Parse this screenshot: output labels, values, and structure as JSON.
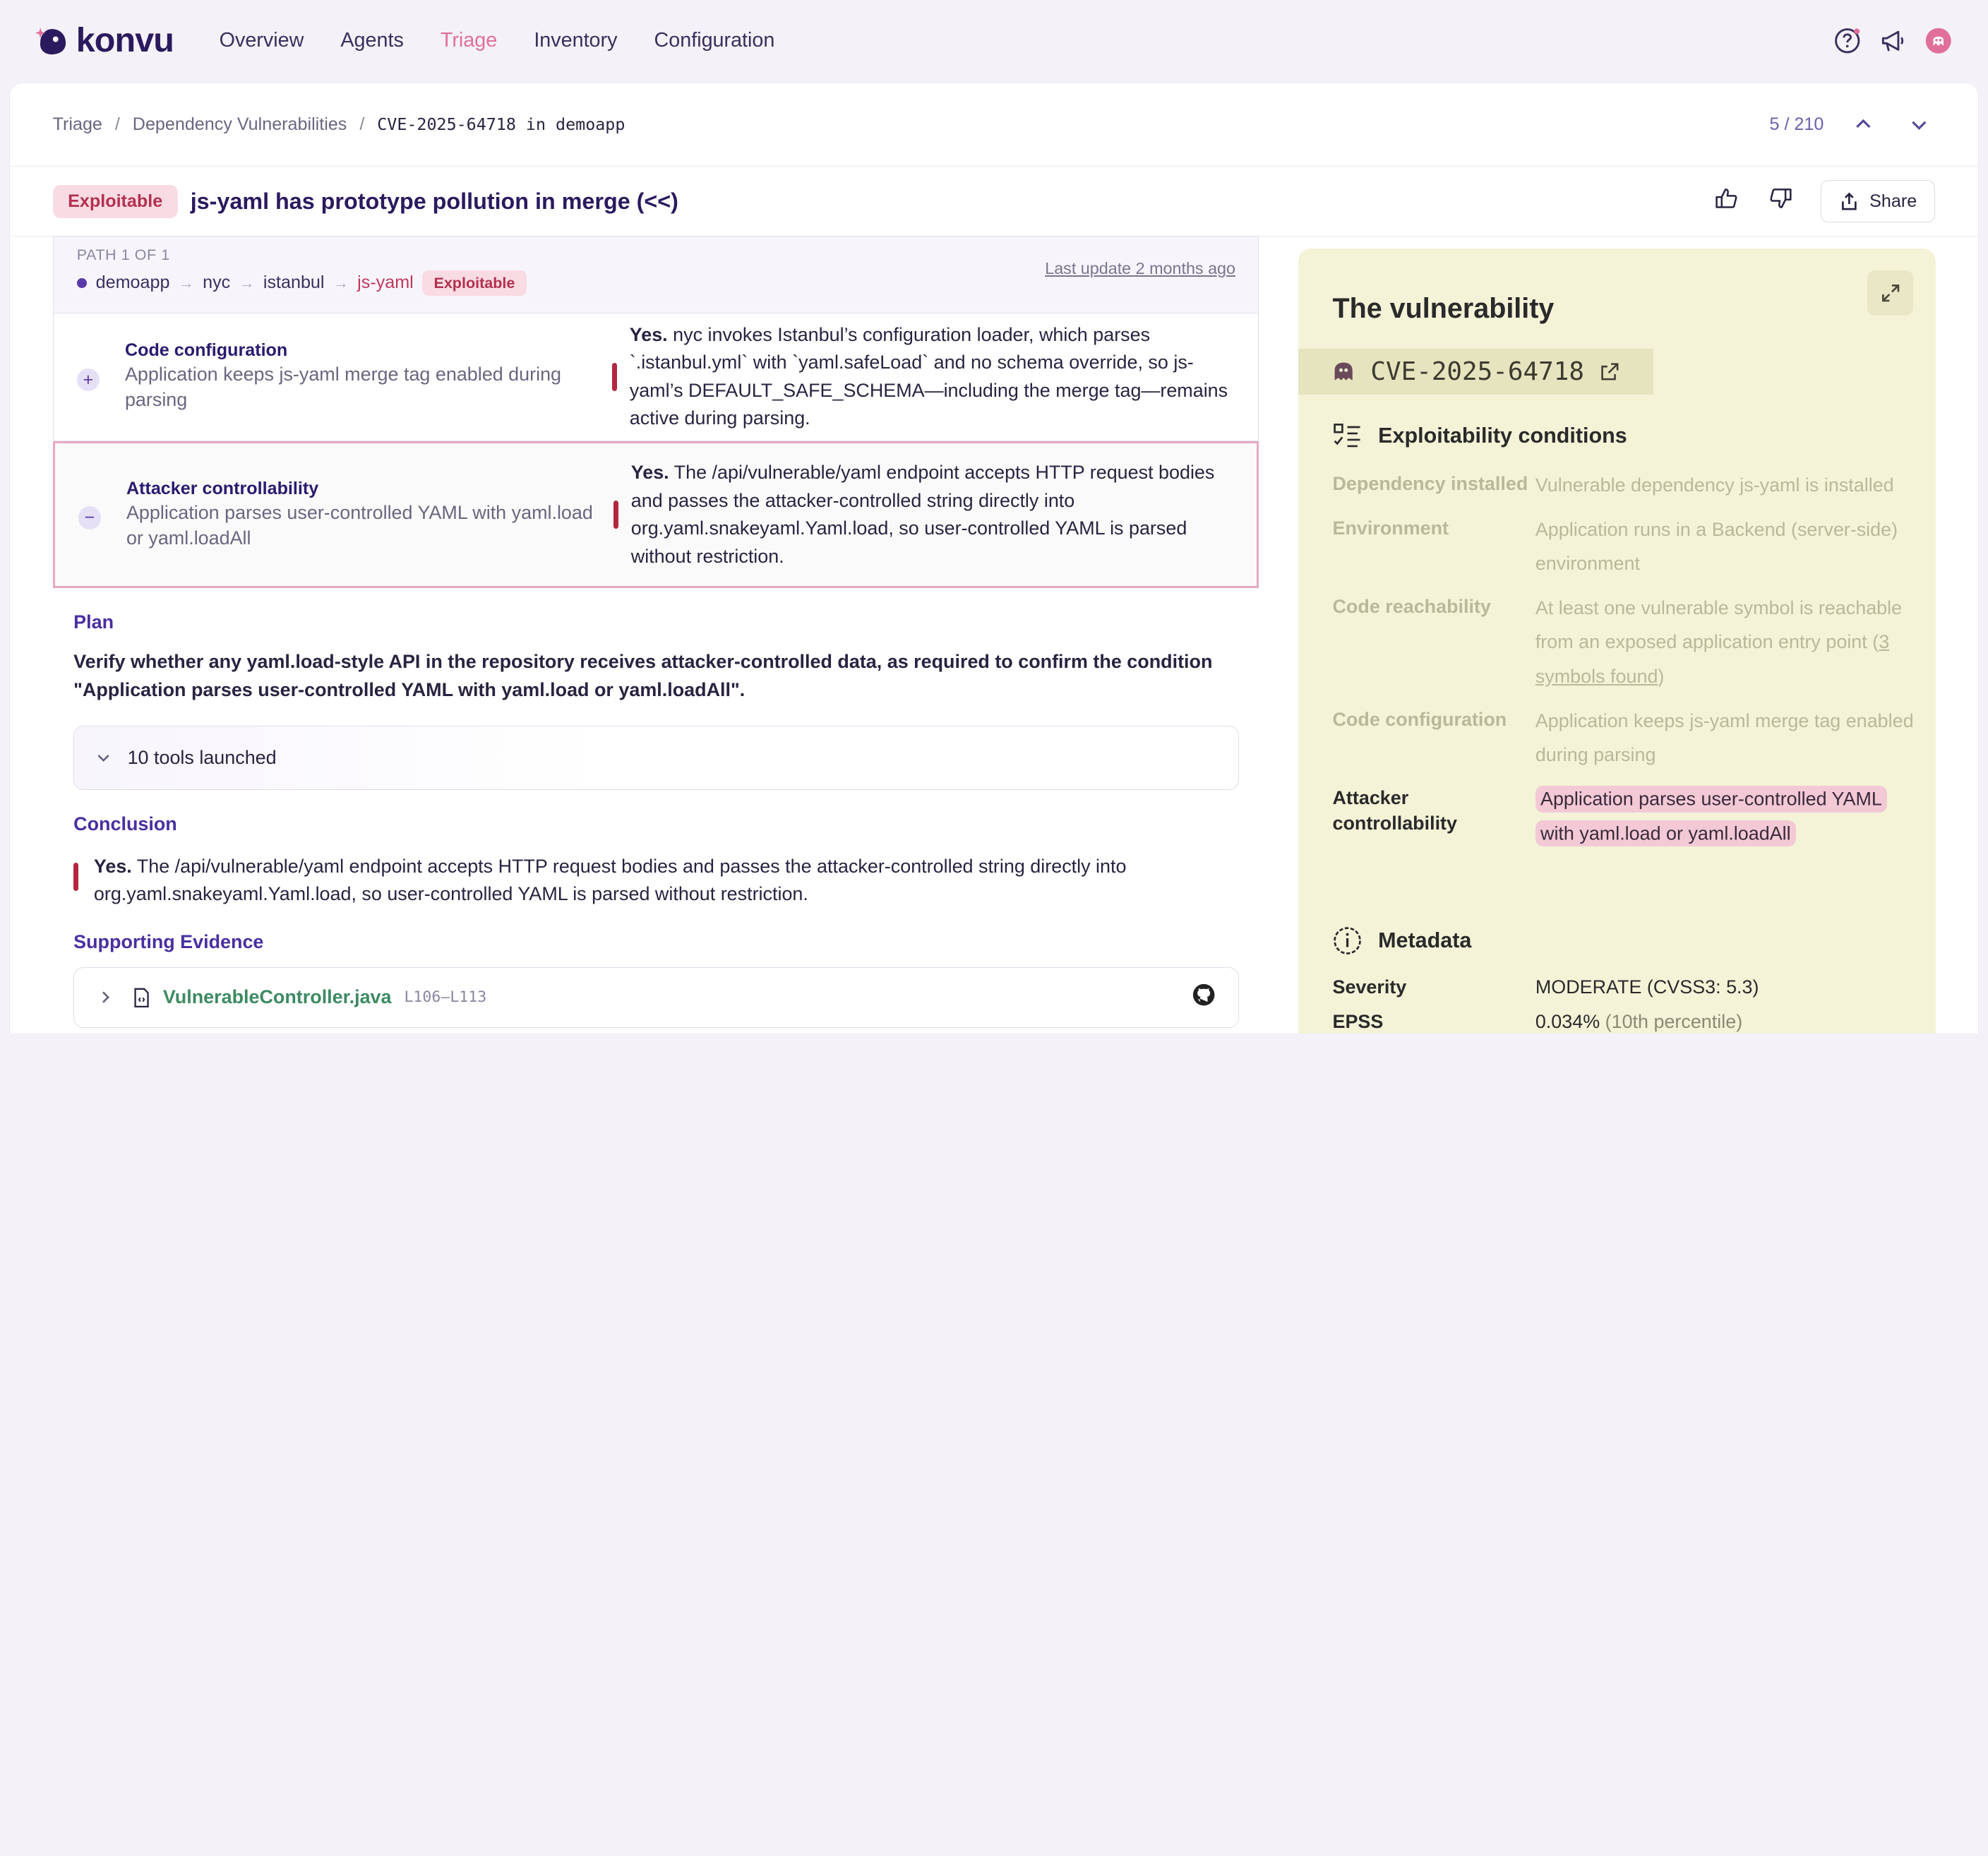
{
  "nav": {
    "logo_text": "konvu",
    "items": [
      "Overview",
      "Agents",
      "Triage",
      "Inventory",
      "Configuration"
    ],
    "active": "Triage"
  },
  "breadcrumb": {
    "items": [
      "Triage",
      "Dependency Vulnerabilities"
    ],
    "current": "CVE-2025-64718 in demoapp",
    "pager": "5 / 210"
  },
  "header": {
    "badge": "Exploitable",
    "title": "js-yaml has prototype pollution in merge (<<)",
    "share_label": "Share"
  },
  "path": {
    "label": "PATH 1 OF 1",
    "nodes": [
      "demoapp",
      "nyc",
      "istanbul",
      "js-yaml"
    ],
    "badge": "Exploitable",
    "last_update": "Last update 2 months ago"
  },
  "conditions": [
    {
      "title": "Code configuration",
      "subtitle": "Application keeps js-yaml merge tag enabled during parsing",
      "answer_yes": "Yes.",
      "answer": " nyc invokes Istanbul’s configuration loader, which parses `.istanbul.yml` with `yaml.safeLoad` and no schema override, so js-yaml’s DEFAULT_SAFE_SCHEMA—including the merge tag—remains active during parsing.",
      "toggle": "+"
    },
    {
      "title": "Attacker controllability",
      "subtitle": "Application parses user-controlled YAML with yaml.load or yaml.loadAll",
      "answer_yes": "Yes.",
      "answer": " The /api/vulnerable/yaml endpoint accepts HTTP request bodies and passes the attacker-controlled string directly into org.yaml.snakeyaml.Yaml.load, so user-controlled YAML is parsed without restriction.",
      "toggle": "−"
    }
  ],
  "plan": {
    "heading": "Plan",
    "text": "Verify whether any yaml.load-style API in the repository receives attacker-controlled data, as required to confirm the condition \"Application parses user-controlled YAML with yaml.load or yaml.loadAll\".",
    "tools_label": "10 tools launched"
  },
  "conclusion": {
    "heading": "Conclusion",
    "yes": "Yes.",
    "text": " The /api/vulnerable/yaml endpoint accepts HTTP request bodies and passes the attacker-controlled string directly into org.yaml.snakeyaml.Yaml.load, so user-controlled YAML is parsed without restriction."
  },
  "evidence": {
    "heading": "Supporting Evidence",
    "file": "VulnerableController.java",
    "lines": "L106–L113"
  },
  "panel": {
    "title": "The vulnerability",
    "cve": "CVE-2025-64718",
    "conditions_heading": "Exploitability conditions",
    "conditions": [
      {
        "key": "Dependency installed",
        "value": "Vulnerable dependency js-yaml is installed"
      },
      {
        "key": "Environment",
        "value": "Application runs in a Backend (server-side) environment"
      },
      {
        "key": "Code reachability",
        "value_pre": "At least one vulnerable symbol is reachable from an exposed application entry point (",
        "link": "3 symbols found",
        "value_post": ")"
      },
      {
        "key": "Code configuration",
        "value": "Application keeps js-yaml merge tag enabled during parsing"
      },
      {
        "key": "Attacker controllability",
        "value": "Application parses user-controlled YAML with yaml.load or yaml.loadAll"
      }
    ],
    "metadata_heading": "Metadata",
    "metadata": [
      {
        "key": "Severity",
        "value": "MODERATE (CVSS3: 5.3)"
      },
      {
        "key": "EPSS",
        "value": "0.034%",
        "muted": "(10th percentile)"
      }
    ]
  },
  "colors": {
    "accent": "#e0709a",
    "brand": "#2b1a5e",
    "exploitable_bg": "#f9dbe3",
    "panel_bg": "#f4f3d8"
  }
}
